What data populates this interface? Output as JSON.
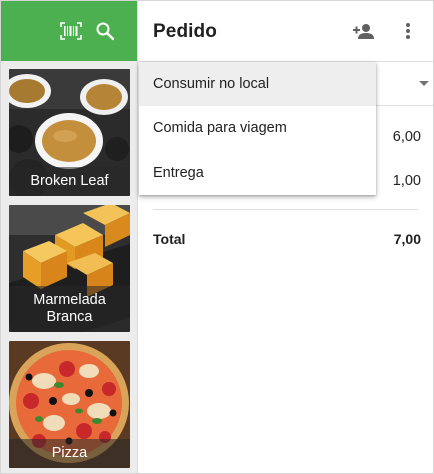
{
  "toolbar": {
    "accent_color": "#4caf50",
    "icons": [
      "barcode-icon",
      "search-icon"
    ]
  },
  "products": [
    {
      "name": "Broken Leaf"
    },
    {
      "name": "Marmelada Branca"
    },
    {
      "name": "Pizza"
    }
  ],
  "order": {
    "title": "Pedido",
    "header_icons": [
      "add-person-icon",
      "more-vert-icon"
    ],
    "lines": [
      {
        "amount": "6,00"
      },
      {
        "amount": "1,00"
      }
    ],
    "total_label": "Total",
    "total_value": "7,00"
  },
  "order_type_menu": {
    "items": [
      "Consumir no local",
      "Comida para viagem",
      "Entrega"
    ],
    "highlighted_index": 0
  }
}
